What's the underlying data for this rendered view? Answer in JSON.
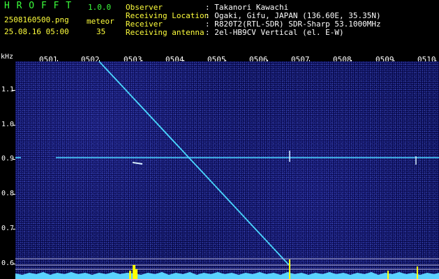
{
  "header": {
    "app_title": "H R O F F T",
    "version": "1.0.0",
    "filename": "2508160500.png",
    "datetime": "25.08.16 05:00",
    "mode_label": "meteor",
    "meteor_count": "35",
    "fields": [
      {
        "label": "Observer",
        "value": ": Takanori Kawachi"
      },
      {
        "label": "Receiving Location",
        "value": ": Ogaki, Gifu, JAPAN (136.60E, 35.35N)"
      },
      {
        "label": "Receiver",
        "value": ": R820T2(RTL-SDR) SDR-Sharp 53.1000MHz"
      },
      {
        "label": "Receiving antenna",
        "value": ": 2el-HB9CV Vertical (el. E-W)"
      }
    ]
  },
  "axes": {
    "y_unit": "kHz",
    "y_ticks": [
      "1.1",
      "1.0",
      "0.9",
      "0.8",
      "0.7",
      "0.6"
    ],
    "x_ticks": [
      "0501",
      "0502",
      "0503",
      "0504",
      "0505",
      "0506",
      "0507",
      "0508",
      "0509",
      "0510"
    ]
  },
  "colors": {
    "background": "#000000",
    "spectrogram": "#080a4a",
    "signal": "#4ad8ff",
    "header_green": "#3cff3c",
    "header_yellow": "#ffff3c",
    "spectrum_fill": "#5ad2ff",
    "spectrum_peak": "#ffff00"
  }
}
